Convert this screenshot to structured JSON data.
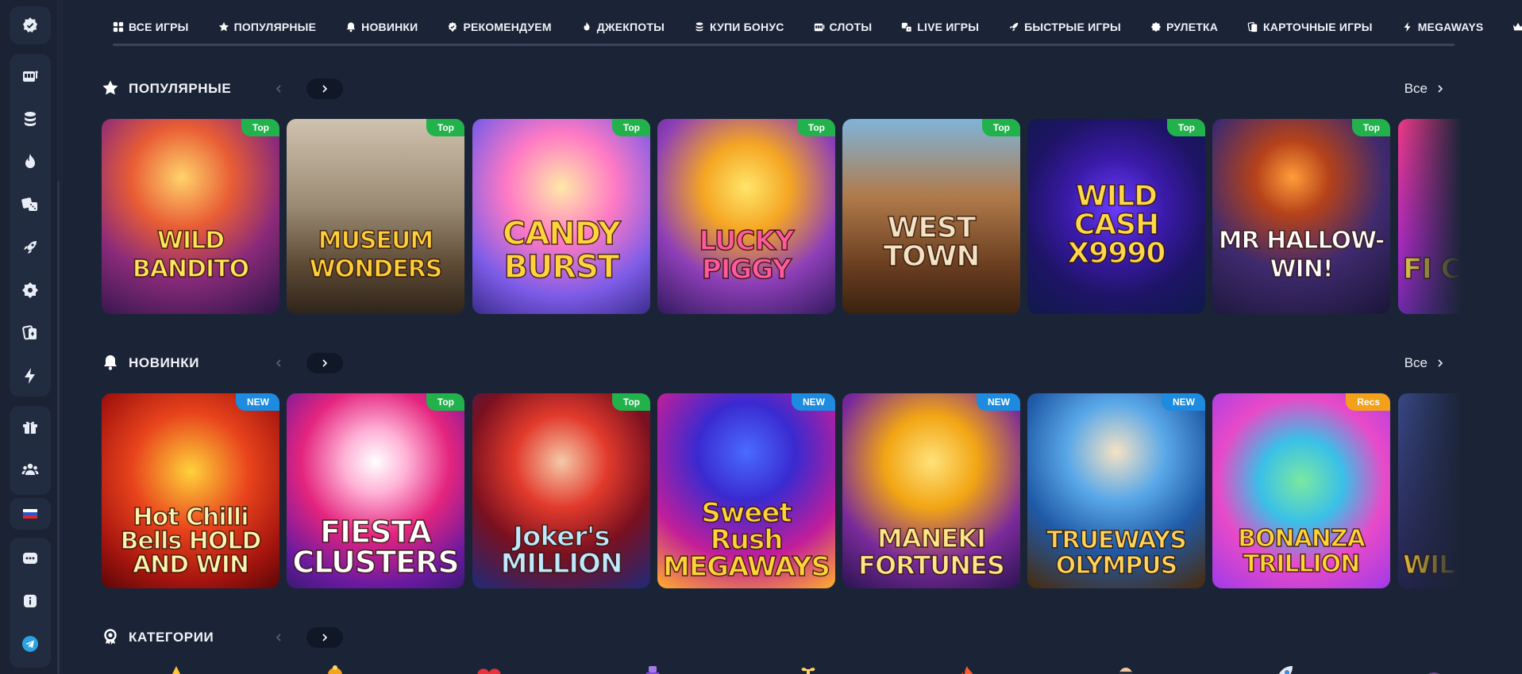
{
  "nav": {
    "tabs": [
      {
        "label": "ВСЕ ИГРЫ",
        "icon": "grid-icon"
      },
      {
        "label": "ПОПУЛЯРНЫЕ",
        "icon": "star-icon"
      },
      {
        "label": "НОВИНКИ",
        "icon": "bell-icon"
      },
      {
        "label": "РЕКОМЕНДУЕМ",
        "icon": "shield-check-icon"
      },
      {
        "label": "ДЖЕКПОТЫ",
        "icon": "fire-icon"
      },
      {
        "label": "КУПИ БОНУС",
        "icon": "coins-icon"
      },
      {
        "label": "СЛОТЫ",
        "icon": "slot-machine-icon"
      },
      {
        "label": "LIVE ИГРЫ",
        "icon": "dice-icon"
      },
      {
        "label": "БЫСТРЫЕ ИГРЫ",
        "icon": "rocket-icon"
      },
      {
        "label": "РУЛЕТКА",
        "icon": "roulette-icon"
      },
      {
        "label": "КАРТОЧНЫЕ ИГРЫ",
        "icon": "cards-icon"
      },
      {
        "label": "MEGAWAYS",
        "icon": "lightning-icon"
      },
      {
        "label": "",
        "icon": "crown-icon"
      }
    ]
  },
  "sidebar": {
    "items": [
      "logo-icon",
      "slot-machine-icon",
      "coins-icon",
      "fire-icon",
      "dice-icon",
      "rocket-icon",
      "roulette-icon",
      "cards-icon",
      "lightning-icon",
      "gift-icon",
      "users-icon",
      "flag-ru-icon",
      "chat-icon",
      "info-icon",
      "telegram-icon"
    ]
  },
  "colors": {
    "background": "#1b2437",
    "sidebar": "#1a2234",
    "badge_top": "#22b24c",
    "badge_new": "#1c8be0",
    "badge_recs": "#f2a21a"
  },
  "sections": [
    {
      "title": "ПОПУЛЯРНЫЕ",
      "icon": "star-icon",
      "see_all": "Все",
      "games": [
        {
          "title": "WILD BANDITO",
          "badge": "Top"
        },
        {
          "title": "MUSEUM WONDERS",
          "badge": "Top"
        },
        {
          "title": "CANDY BURST",
          "badge": "Top"
        },
        {
          "title": "LUCKY PIGGY",
          "badge": "Top"
        },
        {
          "title": "WEST TOWN",
          "badge": "Top"
        },
        {
          "title": "WILD CASH X9990",
          "badge": "Top"
        },
        {
          "title": "MR HALLOW-WIN!",
          "badge": "Top"
        },
        {
          "title": "FI CLU",
          "badge": ""
        }
      ]
    },
    {
      "title": "НОВИНКИ",
      "icon": "bell-icon",
      "see_all": "Все",
      "games": [
        {
          "title": "Hot Chilli Bells HOLD AND WIN",
          "badge": "NEW"
        },
        {
          "title": "FIESTA CLUSTERS",
          "badge": "Top"
        },
        {
          "title": "Joker's MILLION",
          "badge": "Top"
        },
        {
          "title": "Sweet Rush MEGAWAYS",
          "badge": "NEW"
        },
        {
          "title": "MANEKI FORTUNES",
          "badge": "NEW"
        },
        {
          "title": "TRUEWAYS OLYMPUS",
          "badge": "NEW"
        },
        {
          "title": "BONANZA TRILLION",
          "badge": "Recs"
        },
        {
          "title": "WIL",
          "badge": ""
        }
      ]
    },
    {
      "title": "КАТЕГОРИИ",
      "icon": "award-icon"
    }
  ]
}
